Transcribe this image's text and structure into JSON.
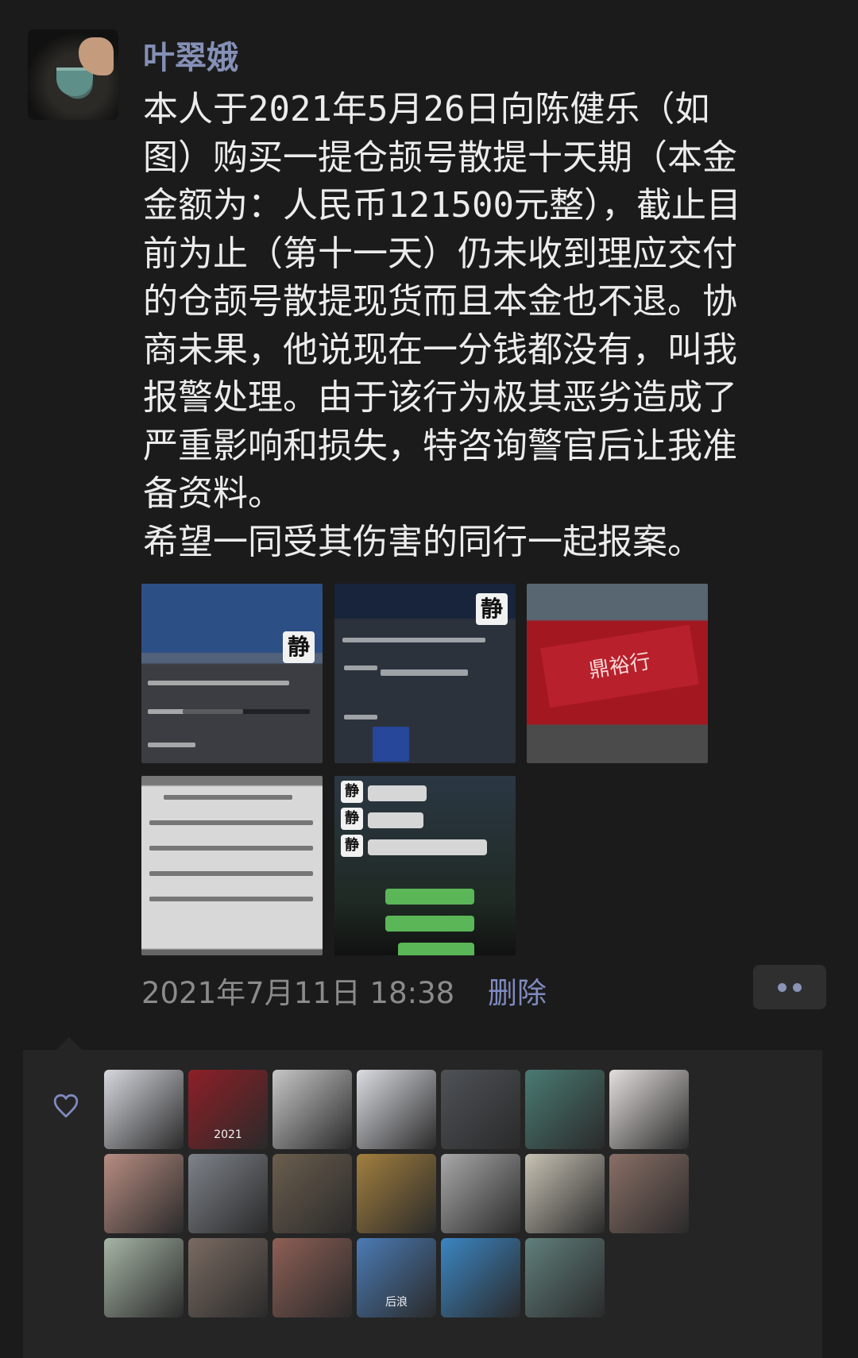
{
  "post": {
    "author": "叶翠娥",
    "content": "本人于2021年5月26日向陈健乐（如\n图）购买一提仓颉号散提十天期（本金\n金额为：人民币121500元整），截止目\n前为止（第十一天）仍未收到理应交付\n的仓颉号散提现货而且本金也不退。协\n商未果，他说现在一分钱都没有，叫我\n报警处理。由于该行为极其恶劣造成了\n严重影响和损失，特咨询警官后让我准\n备资料。\n希望一同受其伤害的同行一起报案。",
    "timestamp": "2021年7月11日 18:38",
    "delete_label": "删除"
  },
  "icons": {
    "more": "more-icon",
    "heart": "heart-icon"
  },
  "colors": {
    "background": "#1b1b1b",
    "name": "#8590b6",
    "delete": "#7f8ac0",
    "likes_bg": "#252525"
  },
  "likers": [
    {
      "name": "liker-1",
      "color": "#d7d8df"
    },
    {
      "name": "liker-2",
      "color": "#8e1f27",
      "text": "2021"
    },
    {
      "name": "liker-3",
      "color": "#c7c7c7"
    },
    {
      "name": "liker-4",
      "color": "#dcdde3"
    },
    {
      "name": "liker-5",
      "color": "#4e5257"
    },
    {
      "name": "liker-6",
      "color": "#4a7a73"
    },
    {
      "name": "liker-7",
      "color": "#e3dfdd"
    },
    {
      "name": "liker-8",
      "color": "#b88d82"
    },
    {
      "name": "liker-9",
      "color": "#7e838a"
    },
    {
      "name": "liker-10",
      "color": "#6b5e4e"
    },
    {
      "name": "liker-11",
      "color": "#a27f3e"
    },
    {
      "name": "liker-12",
      "color": "#a8a8a8"
    },
    {
      "name": "liker-13",
      "color": "#c8c2b4"
    },
    {
      "name": "liker-14",
      "color": "#8a6f66"
    },
    {
      "name": "liker-15",
      "color": "#a6b5a5"
    },
    {
      "name": "liker-16",
      "color": "#7a6b62"
    },
    {
      "name": "liker-17",
      "color": "#8e5f55"
    },
    {
      "name": "liker-18",
      "color": "#4b7bb5",
      "text": "后浪"
    },
    {
      "name": "liker-19",
      "color": "#3b86c3"
    },
    {
      "name": "liker-20",
      "color": "#607f7c"
    }
  ]
}
